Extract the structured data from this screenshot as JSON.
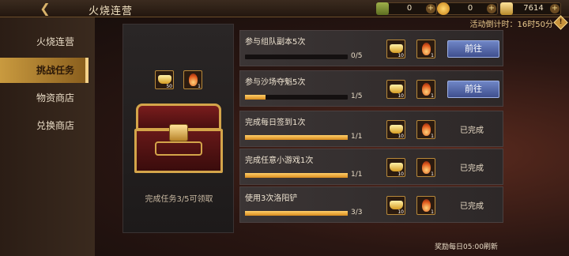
{
  "header": {
    "title": "火烧连营"
  },
  "currencies": [
    {
      "icon": "jade-token-icon",
      "value": "0"
    },
    {
      "icon": "gold-coin-icon",
      "value": "0"
    },
    {
      "icon": "gold-ingot-icon",
      "value": "7614"
    }
  ],
  "countdown": "活动倒计时：16时50分",
  "sidebar": {
    "items": [
      {
        "label": "火烧连营"
      },
      {
        "label": "挑战任务"
      },
      {
        "label": "物资商店"
      },
      {
        "label": "兑换商店"
      }
    ]
  },
  "reward_panel": {
    "items": [
      {
        "icon": "gold-ingot-icon",
        "count": "50"
      },
      {
        "icon": "fire-token-icon",
        "count": "1"
      }
    ],
    "hint": "完成任务3/5可领取"
  },
  "tasks": [
    {
      "label": "参与组队副本5次",
      "progress_text": "0/5",
      "progress": 0.0,
      "rewards": [
        "10",
        "1"
      ],
      "action": "前往"
    },
    {
      "label": "参与沙场夺魁5次",
      "progress_text": "1/5",
      "progress": 0.2,
      "rewards": [
        "10",
        "1"
      ],
      "action": "前往"
    },
    {
      "label": "完成每日签到1次",
      "progress_text": "1/1",
      "progress": 1.0,
      "rewards": [
        "10",
        "1"
      ],
      "action": "已完成"
    },
    {
      "label": "完成任意小游戏1次",
      "progress_text": "1/1",
      "progress": 1.0,
      "rewards": [
        "10",
        "1"
      ],
      "action": "已完成"
    },
    {
      "label": "使用3次洛阳铲",
      "progress_text": "3/3",
      "progress": 1.0,
      "rewards": [
        "10",
        "1"
      ],
      "action": "已完成"
    }
  ],
  "refresh_note": "奖励每日05:00刷新"
}
